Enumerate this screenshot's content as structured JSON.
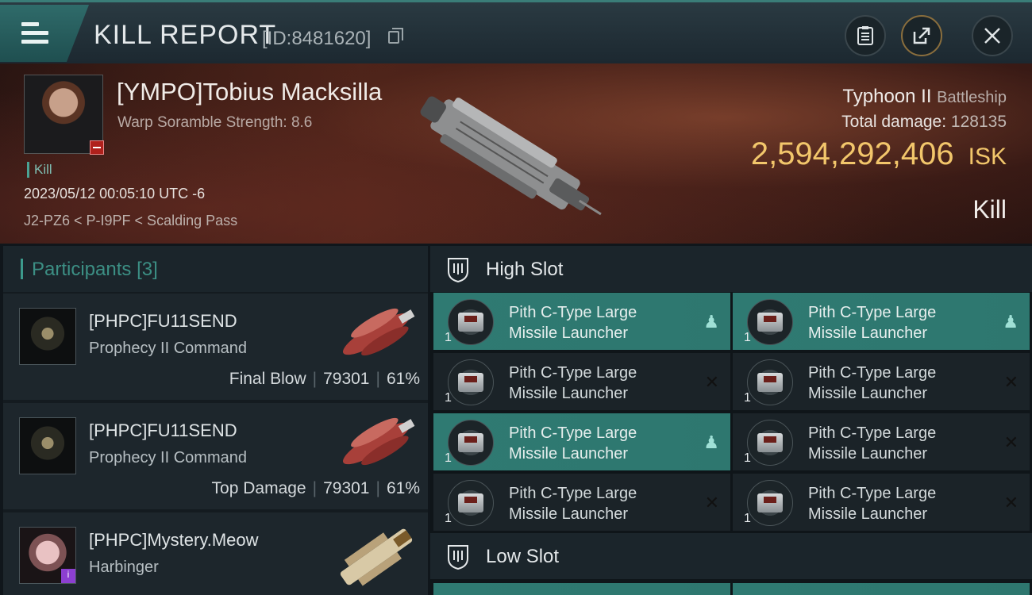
{
  "header": {
    "title": "KILL REPORT",
    "report_id": "[ID:8481620]"
  },
  "victim": {
    "name": "[YMPO]Tobius Macksilla",
    "scramble": "Warp Soramble Strength: 8.6",
    "tag": "Kill",
    "datetime": "2023/05/12 00:05:10 UTC -6",
    "location": "J2-PZ6 < P-I9PF < Scalding Pass",
    "ship": "Typhoon II",
    "ship_class": "Battleship",
    "total_damage_label": "Total damage:",
    "total_damage": "128135",
    "isk_value": "2,594,292,406",
    "isk_unit": "ISK",
    "result": "Kill"
  },
  "participants": {
    "title": "Participants",
    "count": "[3]",
    "rows": [
      {
        "name": "[PHPC]FU11SEND",
        "ship": "Prophecy II Command",
        "stat_label": "Final Blow",
        "damage": "79301",
        "percent": "61%"
      },
      {
        "name": "[PHPC]FU11SEND",
        "ship": "Prophecy II Command",
        "stat_label": "Top Damage",
        "damage": "79301",
        "percent": "61%"
      },
      {
        "name": "[PHPC]Mystery.Meow",
        "ship": "Harbinger"
      }
    ]
  },
  "slots": {
    "high_label": "High Slot",
    "low_label": "Low Slot",
    "modules": [
      {
        "line1": "Pith C-Type Large",
        "line2": "Missile Launcher",
        "qty": "1",
        "state": "dropped"
      },
      {
        "line1": "Pith C-Type Large",
        "line2": "Missile Launcher",
        "qty": "1",
        "state": "dropped"
      },
      {
        "line1": "Pith C-Type Large",
        "line2": "Missile Launcher",
        "qty": "1",
        "state": "destroyed"
      },
      {
        "line1": "Pith C-Type Large",
        "line2": "Missile Launcher",
        "qty": "1",
        "state": "destroyed"
      },
      {
        "line1": "Pith C-Type Large",
        "line2": "Missile Launcher",
        "qty": "1",
        "state": "dropped"
      },
      {
        "line1": "Pith C-Type Large",
        "line2": "Missile Launcher",
        "qty": "1",
        "state": "destroyed"
      },
      {
        "line1": "Pith C-Type Large",
        "line2": "Missile Launcher",
        "qty": "1",
        "state": "destroyed"
      },
      {
        "line1": "Pith C-Type Large",
        "line2": "Missile Launcher",
        "qty": "1",
        "state": "destroyed"
      }
    ]
  },
  "colors": {
    "accent_teal": "#2f7a72",
    "isk_gold": "#f2c66b"
  }
}
